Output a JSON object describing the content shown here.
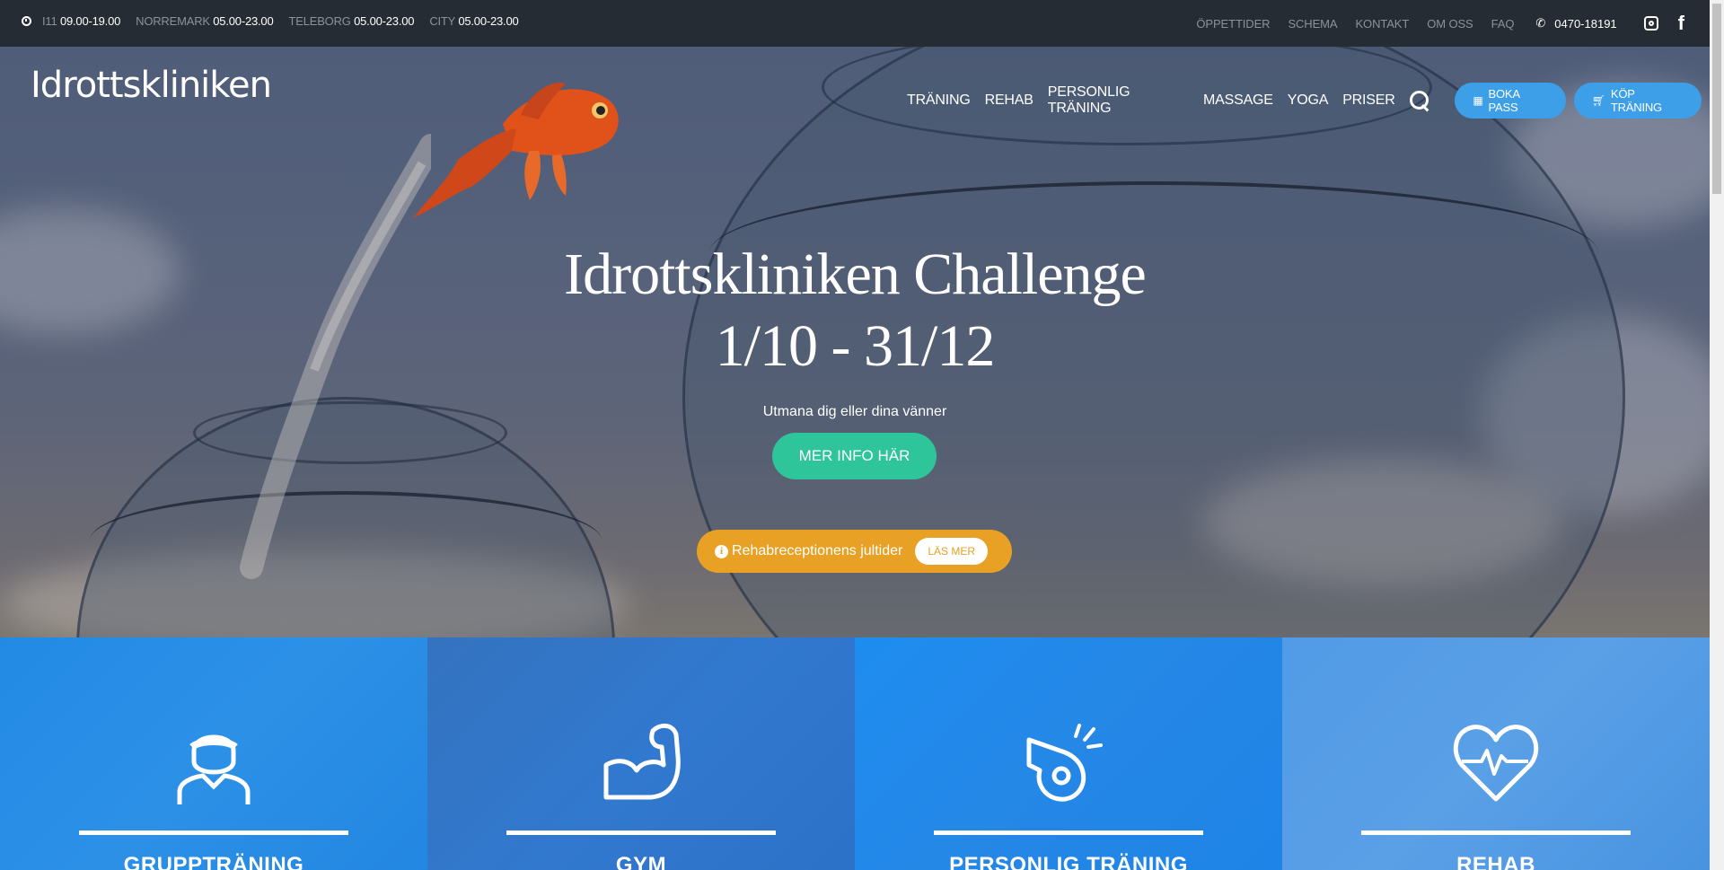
{
  "topbar": {
    "hours": [
      {
        "location": "I11",
        "time": "09.00-19.00"
      },
      {
        "location": "NORREMARK",
        "time": "05.00-23.00"
      },
      {
        "location": "TELEBORG",
        "time": "05.00-23.00"
      },
      {
        "location": "CITY",
        "time": "05.00-23.00"
      }
    ],
    "links": [
      "ÖPPETTIDER",
      "SCHEMA",
      "KONTAKT",
      "OM OSS",
      "FAQ"
    ],
    "phone": "0470-18191",
    "icons": [
      "clock-icon",
      "phone-icon",
      "instagram-icon",
      "facebook-icon"
    ]
  },
  "header": {
    "logo": "Idrottskliniken",
    "nav": [
      "TRÄNING",
      "REHAB",
      "PERSONLIG TRÄNING",
      "MASSAGE",
      "YOGA",
      "PRISER"
    ],
    "boka_pass": "BOKA PASS",
    "kop_traning": "KÖP TRÄNING"
  },
  "hero": {
    "title_line1": "Idrottskliniken Challenge",
    "title_line2": "1/10 - 31/12",
    "subtitle": "Utmana dig eller dina vänner",
    "cta": "MER INFO HÄR",
    "notice_text": "Rehabreceptionens jultider",
    "notice_button": "LÄS MER"
  },
  "cards": [
    {
      "title": "GRUPPTRÄNING",
      "icon": "person-headband-icon"
    },
    {
      "title": "GYM",
      "icon": "flexed-arm-icon"
    },
    {
      "title": "PERSONLIG TRÄNING",
      "icon": "whistle-icon"
    },
    {
      "title": "REHAB",
      "icon": "heart-pulse-icon"
    }
  ],
  "colors": {
    "topbar_bg": "#262c33",
    "accent_blue": "#3d9fe8",
    "cta_green": "#2fc59a",
    "notice_orange": "#e8a124",
    "card_blue": "#1e8ef0"
  }
}
